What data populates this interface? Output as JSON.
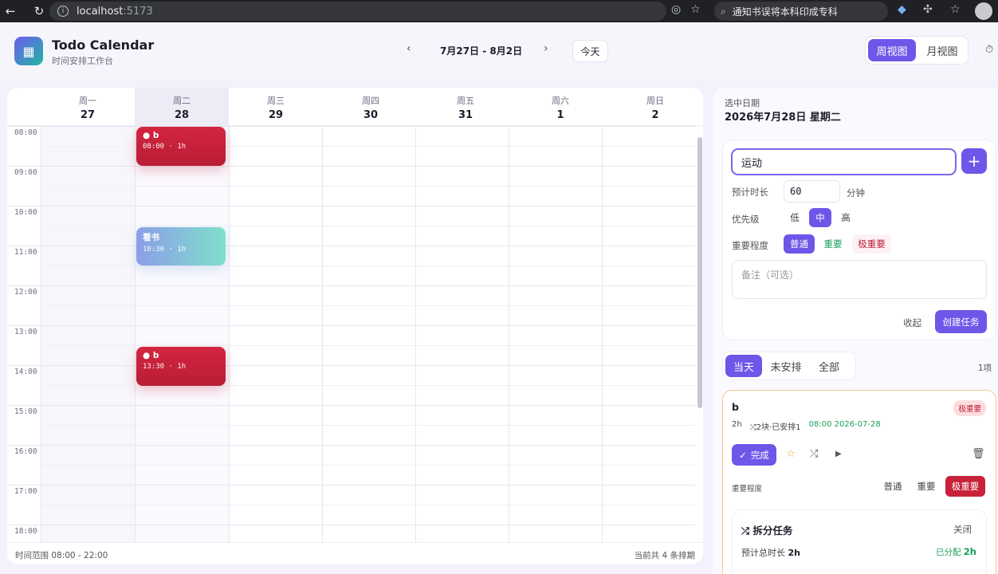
{
  "browser": {
    "url_host": "localhost",
    "url_port": ":5173",
    "search_text": "通知书误将本科印成专科"
  },
  "header": {
    "app_title": "Todo Calendar",
    "app_subtitle": "时间安排工作台",
    "week_range": "7月27日 - 8月2日",
    "today_label": "今天",
    "view_week": "周视图",
    "view_month": "月视图"
  },
  "calendar": {
    "days": [
      {
        "weekday": "周一",
        "date": "27"
      },
      {
        "weekday": "周二",
        "date": "28"
      },
      {
        "weekday": "周三",
        "date": "29"
      },
      {
        "weekday": "周四",
        "date": "30"
      },
      {
        "weekday": "周五",
        "date": "31"
      },
      {
        "weekday": "周六",
        "date": "1"
      },
      {
        "weekday": "周日",
        "date": "2"
      }
    ],
    "hours": [
      "08:00",
      "09:00",
      "10:00",
      "11:00",
      "12:00",
      "13:00",
      "14:00",
      "15:00",
      "16:00",
      "17:00",
      "18:00"
    ],
    "events": [
      {
        "title": "● b",
        "time": "08:00 · 1h"
      },
      {
        "title": "看书",
        "time": "10:30 · 1h"
      },
      {
        "title": "● b",
        "time": "13:30 · 1h"
      }
    ],
    "footer_left": "时间范围 08:00 - 22:00",
    "footer_right": "当前共 4 条排期"
  },
  "side": {
    "selected_label": "选中日期",
    "selected_date": "2026年7月28日 星期二",
    "form": {
      "task_value": "运动",
      "duration_label": "预计时长",
      "duration_value": "60",
      "duration_unit": "分钟",
      "priority_label": "优先级",
      "priority_options": [
        "低",
        "中",
        "高"
      ],
      "importance_label": "重要程度",
      "importance_options": [
        "普通",
        "重要",
        "极重要"
      ],
      "notes_placeholder": "备注（可选）",
      "collapse_label": "收起",
      "create_label": "创建任务"
    },
    "filter_tabs": [
      "当天",
      "未安排",
      "全部"
    ],
    "count": "1项",
    "task": {
      "title": "b",
      "badge": "极重要",
      "duration": "2h",
      "blocks": "⤮2块·已安排1",
      "scheduled": "08:00 2026-07-28",
      "done_label": "完成",
      "importance_label": "重要程度",
      "importance_options": [
        "普通",
        "重要",
        "极重要"
      ],
      "split": {
        "title": "拆分任务",
        "close": "关闭",
        "total_label": "预计总时长",
        "total_value": "2h",
        "allocated_label": "已分配",
        "allocated_value": "2h"
      }
    }
  },
  "colors": {
    "accent": "#6d57e8",
    "event_red": "#c8213a",
    "success": "#1a9e5c"
  }
}
